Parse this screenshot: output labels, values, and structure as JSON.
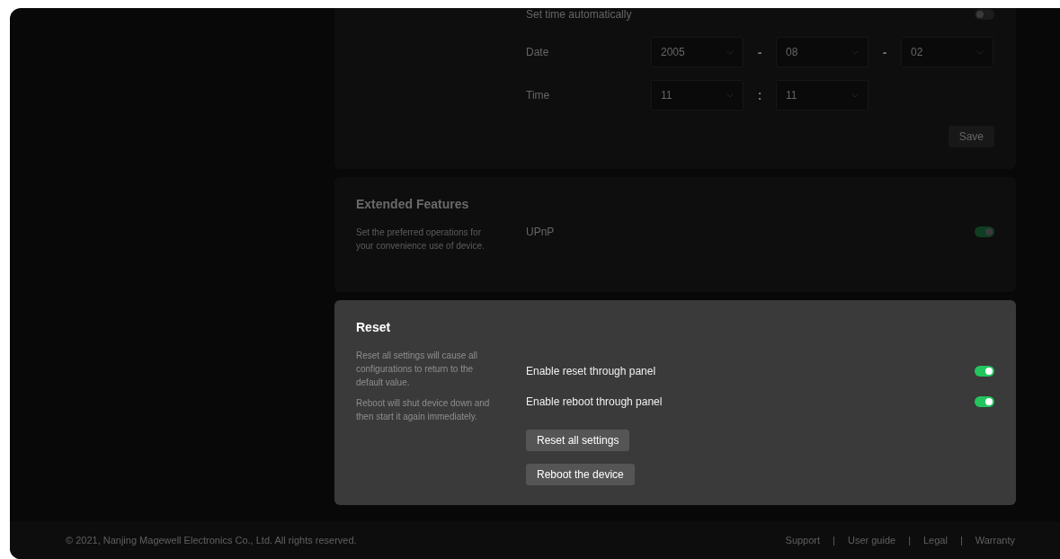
{
  "time_card": {
    "auto_label": "Set time automatically",
    "auto_on": false,
    "date_label": "Date",
    "date": [
      {
        "value": "2005"
      },
      {
        "value": "08"
      },
      {
        "value": "02"
      }
    ],
    "date_separator": "-",
    "time_label": "Time",
    "time": [
      {
        "value": "11"
      },
      {
        "value": "11"
      }
    ],
    "time_separator": ":",
    "save": "Save"
  },
  "extended": {
    "title": "Extended Features",
    "description": "Set the preferred operations for your convenience use of device.",
    "options": [
      {
        "label": "UPnP",
        "on": true
      }
    ]
  },
  "reset": {
    "title": "Reset",
    "descriptions": [
      "Reset all settings will cause all configurations to return to the default value.",
      "Reboot will shut device down and then start it again immediately."
    ],
    "options": [
      {
        "label": "Enable reset through panel",
        "on": true
      },
      {
        "label": "Enable reboot through panel",
        "on": true
      }
    ],
    "buttons": [
      "Reset all settings",
      "Reboot the device"
    ]
  },
  "footer": {
    "copyright": "© 2021, Nanjing Magewell Electronics Co., Ltd. All rights reserved.",
    "links": [
      "Support",
      "User guide",
      "Legal",
      "Warranty"
    ],
    "separator": "|"
  }
}
